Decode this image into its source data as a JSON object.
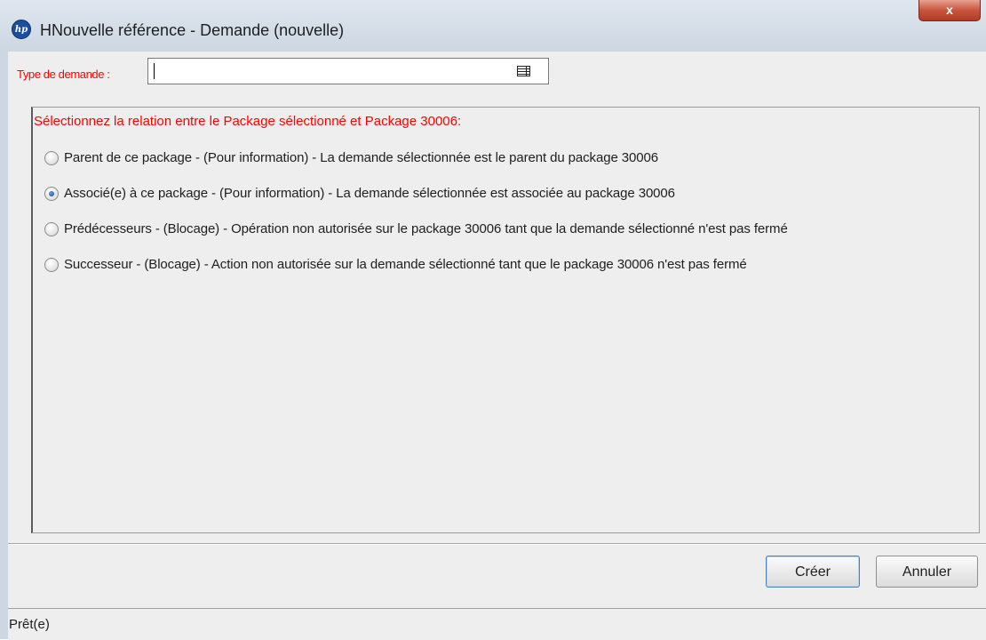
{
  "window": {
    "title": "HNouvelle référence - Demande (nouvelle)",
    "app_icon_label": "hp",
    "close_label": "x"
  },
  "form": {
    "type_label": "Type de demande :",
    "type_value": ""
  },
  "relation": {
    "title": "Sélectionnez la relation entre le Package sélectionné et Package 30006:",
    "options": [
      {
        "label": "Parent de ce package - (Pour information) - La demande sélectionnée est le parent du package 30006",
        "checked": false
      },
      {
        "label": "Associé(e) à ce package - (Pour information) - La demande sélectionnée est associée au package 30006",
        "checked": true
      },
      {
        "label": "Prédécesseurs - (Blocage) - Opération non autorisée sur le package 30006 tant que la demande sélectionné n'est pas fermé",
        "checked": false
      },
      {
        "label": "Successeur - (Blocage) - Action non autorisée sur la demande sélectionné tant que le package 30006 n'est pas fermé",
        "checked": false
      }
    ]
  },
  "buttons": {
    "create": "Créer",
    "cancel": "Annuler"
  },
  "status": {
    "text": "Prêt(e)"
  },
  "colors": {
    "required_label": "#ff0000",
    "title_bar": "#cdd7e2",
    "close_button": "#c8553e"
  }
}
